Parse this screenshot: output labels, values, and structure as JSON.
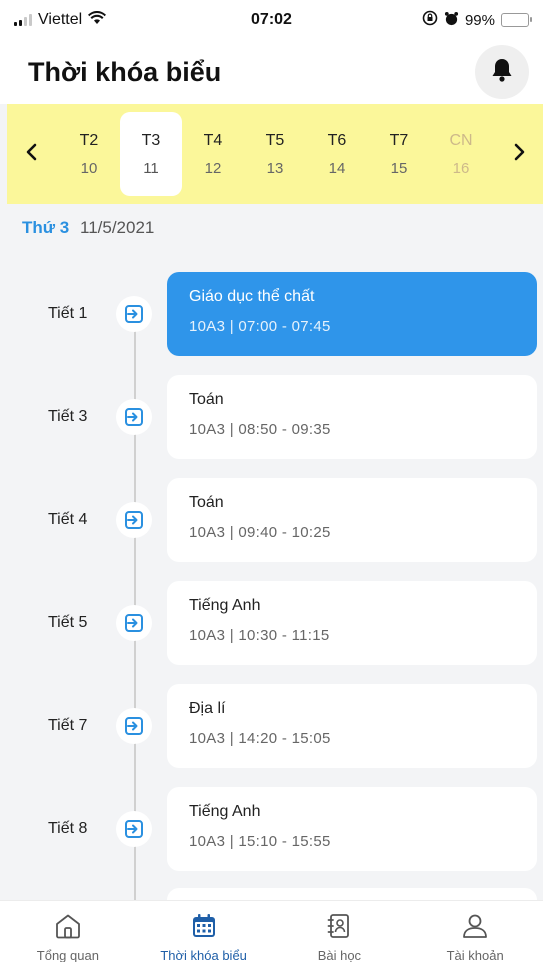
{
  "status_bar": {
    "carrier": "Viettel",
    "time": "07:02",
    "battery": "99%"
  },
  "header": {
    "title": "Thời khóa biểu"
  },
  "week": {
    "days": [
      {
        "name": "T2",
        "date": "10"
      },
      {
        "name": "T3",
        "date": "11"
      },
      {
        "name": "T4",
        "date": "12"
      },
      {
        "name": "T5",
        "date": "13"
      },
      {
        "name": "T6",
        "date": "14"
      },
      {
        "name": "T7",
        "date": "15"
      },
      {
        "name": "CN",
        "date": "16"
      }
    ],
    "selected_index": 1
  },
  "selected_date": {
    "weekday": "Thứ 3",
    "date": "11/5/2021"
  },
  "schedule": [
    {
      "period": "Tiết 1",
      "subject": "Giáo dục thể chất",
      "meta": "10A3  |  07:00 - 07:45"
    },
    {
      "period": "Tiết 3",
      "subject": "Toán",
      "meta": "10A3  |  08:50 - 09:35"
    },
    {
      "period": "Tiết 4",
      "subject": "Toán",
      "meta": "10A3  |  09:40 - 10:25"
    },
    {
      "period": "Tiết 5",
      "subject": "Tiếng Anh",
      "meta": "10A3  |  10:30 - 11:15"
    },
    {
      "period": "Tiết 7",
      "subject": "Địa lí",
      "meta": "10A3  |  14:20 - 15:05"
    },
    {
      "period": "Tiết 8",
      "subject": "Tiếng Anh",
      "meta": "10A3  |  15:10 - 15:55"
    }
  ],
  "bottom_nav": [
    {
      "label": "Tổng quan",
      "icon": "home-icon"
    },
    {
      "label": "Thời khóa biểu",
      "icon": "calendar-icon"
    },
    {
      "label": "Bài học",
      "icon": "contact-book-icon"
    },
    {
      "label": "Tài khoản",
      "icon": "user-icon"
    }
  ],
  "colors": {
    "accent": "#2f95ea",
    "week_bar": "#fbf79a",
    "nav_active": "#1f5fa8"
  }
}
